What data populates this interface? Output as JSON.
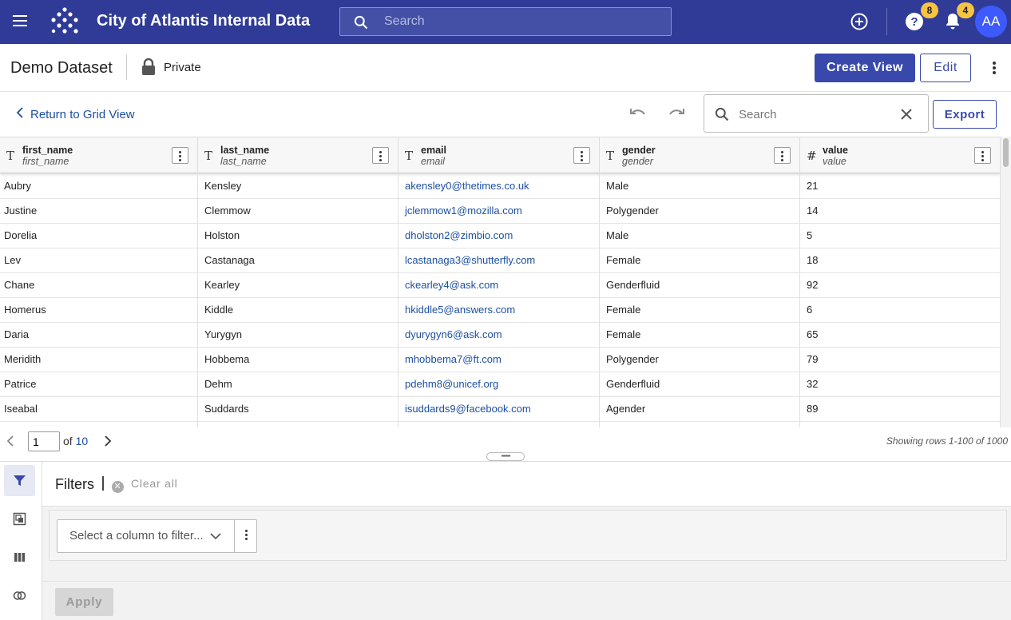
{
  "topbar": {
    "app_title": "City of Atlantis Internal Data",
    "search_placeholder": "Search",
    "help_badge": "8",
    "notif_badge": "4",
    "avatar_initials": "AA",
    "color": "#2f3b96"
  },
  "dataset": {
    "title": "Demo Dataset",
    "privacy": "Private",
    "create_view_label": "Create View",
    "edit_label": "Edit"
  },
  "toolbar": {
    "back_label": "Return to Grid View",
    "search_placeholder": "Search",
    "export_label": "Export"
  },
  "grid": {
    "columns": [
      {
        "type": "T",
        "name": "first_name",
        "field": "first_name"
      },
      {
        "type": "T",
        "name": "last_name",
        "field": "last_name"
      },
      {
        "type": "T",
        "name": "email",
        "field": "email"
      },
      {
        "type": "T",
        "name": "gender",
        "field": "gender"
      },
      {
        "type": "#",
        "name": "value",
        "field": "value"
      }
    ],
    "rows": [
      [
        "Aubry",
        "Kensley",
        "akensley0@thetimes.co.uk",
        "Male",
        "21"
      ],
      [
        "Justine",
        "Clemmow",
        "jclemmow1@mozilla.com",
        "Polygender",
        "14"
      ],
      [
        "Dorelia",
        "Holston",
        "dholston2@zimbio.com",
        "Male",
        "5"
      ],
      [
        "Lev",
        "Castanaga",
        "lcastanaga3@shutterfly.com",
        "Female",
        "18"
      ],
      [
        "Chane",
        "Kearley",
        "ckearley4@ask.com",
        "Genderfluid",
        "92"
      ],
      [
        "Homerus",
        "Kiddle",
        "hkiddle5@answers.com",
        "Female",
        "6"
      ],
      [
        "Daria",
        "Yurygyn",
        "dyurygyn6@ask.com",
        "Female",
        "65"
      ],
      [
        "Meridith",
        "Hobbema",
        "mhobbema7@ft.com",
        "Polygender",
        "79"
      ],
      [
        "Patrice",
        "Dehm",
        "pdehm8@unicef.org",
        "Genderfluid",
        "32"
      ],
      [
        "Iseabal",
        "Suddards",
        "isuddards9@facebook.com",
        "Agender",
        "89"
      ],
      [
        "",
        "",
        "",
        "",
        ""
      ]
    ]
  },
  "pager": {
    "page": "1",
    "of_label": "of",
    "total_pages": "10",
    "showing": "Showing rows 1-100 of 1000"
  },
  "filters": {
    "title": "Filters",
    "clear_all": "Clear all",
    "select_placeholder": "Select a column to filter...",
    "apply_label": "Apply"
  }
}
